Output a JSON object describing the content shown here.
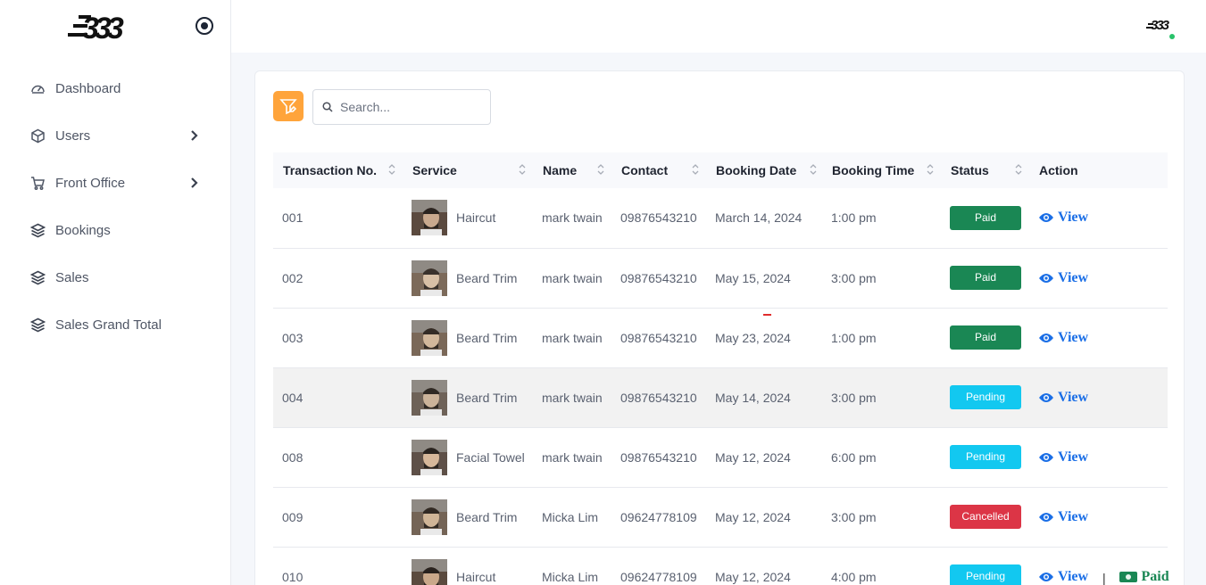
{
  "brand": {
    "logo_text": "333"
  },
  "sidebar": {
    "items": [
      {
        "label": "Dashboard",
        "icon": "gauge-icon",
        "has_submenu": false
      },
      {
        "label": "Users",
        "icon": "cube-icon",
        "has_submenu": true
      },
      {
        "label": "Front Office",
        "icon": "cart-icon",
        "has_submenu": true
      },
      {
        "label": "Bookings",
        "icon": "layers-icon",
        "has_submenu": false
      },
      {
        "label": "Sales",
        "icon": "layers-icon",
        "has_submenu": false
      },
      {
        "label": "Sales Grand Total",
        "icon": "layers-icon",
        "has_submenu": false
      }
    ]
  },
  "toolbar": {
    "search_placeholder": "Search..."
  },
  "table": {
    "columns": [
      "Transaction No.",
      "Service",
      "Name",
      "Contact",
      "Booking Date",
      "Booking Time",
      "Status",
      "Action"
    ],
    "rows": [
      {
        "transaction_no": "001",
        "service": "Haircut",
        "name": "mark twain",
        "contact": "09876543210",
        "booking_date": "March 14, 2024",
        "booking_time": "1:00 pm",
        "status": "Paid",
        "action": "View"
      },
      {
        "transaction_no": "002",
        "service": "Beard Trim",
        "name": "mark twain",
        "contact": "09876543210",
        "booking_date": "May 15, 2024",
        "booking_time": "3:00 pm",
        "status": "Paid",
        "action": "View"
      },
      {
        "transaction_no": "003",
        "service": "Beard Trim",
        "name": "mark twain",
        "contact": "09876543210",
        "booking_date": "May 23, 2024",
        "booking_time": "1:00 pm",
        "status": "Paid",
        "action": "View"
      },
      {
        "transaction_no": "004",
        "service": "Beard Trim",
        "name": "mark twain",
        "contact": "09876543210",
        "booking_date": "May 14, 2024",
        "booking_time": "3:00 pm",
        "status": "Pending",
        "action": "View"
      },
      {
        "transaction_no": "008",
        "service": "Facial Towel",
        "name": "mark twain",
        "contact": "09876543210",
        "booking_date": "May 12, 2024",
        "booking_time": "6:00 pm",
        "status": "Pending",
        "action": "View"
      },
      {
        "transaction_no": "009",
        "service": "Beard Trim",
        "name": "Micka Lim",
        "contact": "09624778109",
        "booking_date": "May 12, 2024",
        "booking_time": "3:00 pm",
        "status": "Cancelled",
        "action": "View"
      },
      {
        "transaction_no": "010",
        "service": "Haircut",
        "name": "Micka Lim",
        "contact": "09624778109",
        "booking_date": "May 12, 2024",
        "booking_time": "4:00 pm",
        "status": "Pending",
        "action": "View",
        "separator": "|",
        "secondary_action": "Paid"
      }
    ]
  },
  "colors": {
    "paid": "#1a8754",
    "pending": "#12c8f0",
    "cancelled": "#dc3546",
    "link": "#1a6ee6",
    "filter": "#ffa43b"
  }
}
